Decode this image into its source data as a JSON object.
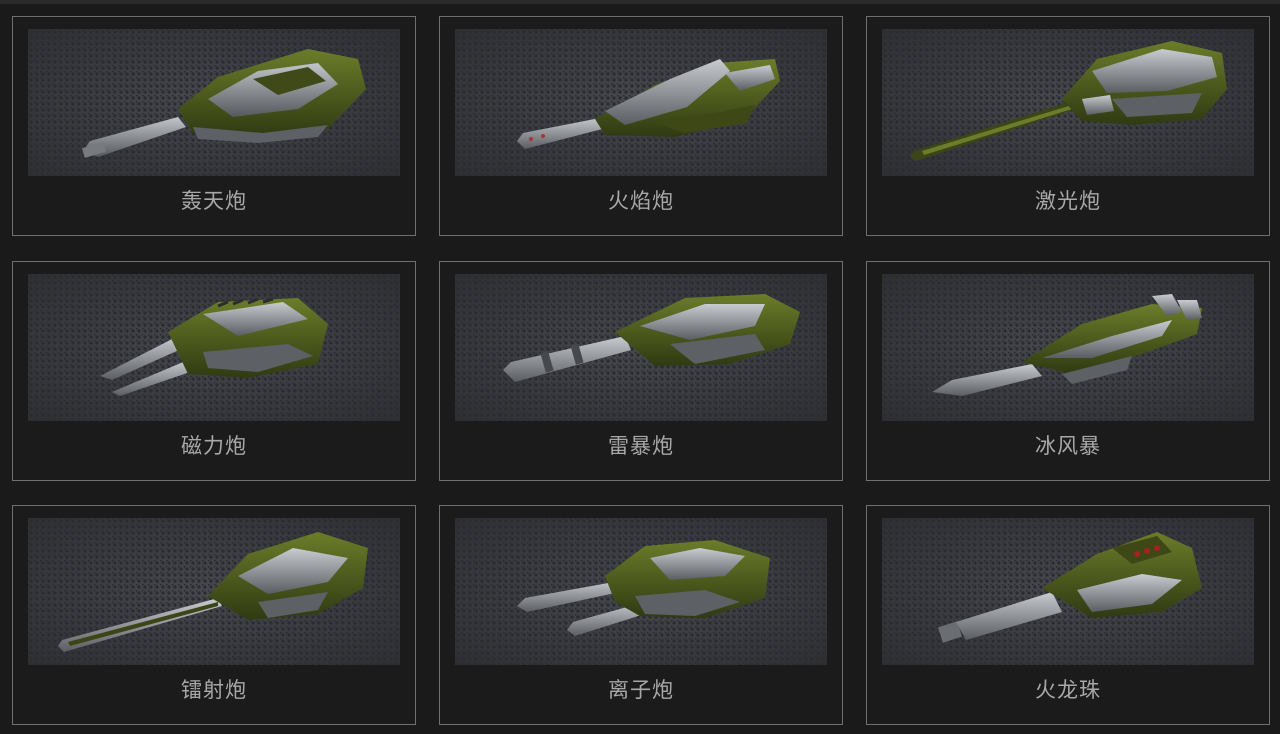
{
  "turrets": [
    {
      "label": "轰天炮",
      "icon": "thunder-turret-icon",
      "shape": "smoky"
    },
    {
      "label": "火焰炮",
      "icon": "firebird-turret-icon",
      "shape": "firebird"
    },
    {
      "label": "激光炮",
      "icon": "railgun-turret-icon",
      "shape": "railgun"
    },
    {
      "label": "磁力炮",
      "icon": "isida-turret-icon",
      "shape": "isida"
    },
    {
      "label": "雷暴炮",
      "icon": "thunder-storm-turret-icon",
      "shape": "thunder"
    },
    {
      "label": "冰风暴",
      "icon": "freeze-turret-icon",
      "shape": "freeze"
    },
    {
      "label": "镭射炮",
      "icon": "ricochet-turret-icon",
      "shape": "ricochet"
    },
    {
      "label": "离子炮",
      "icon": "twins-turret-icon",
      "shape": "twins"
    },
    {
      "label": "火龙珠",
      "icon": "shaft-turret-icon",
      "shape": "dragon"
    }
  ],
  "colors": {
    "background": "#1a1a1b",
    "card_border": "#6f6f6f",
    "label_text": "#a8a8a8",
    "camo_green": "#4b5a1f",
    "metal_grey": "#8e9196"
  }
}
